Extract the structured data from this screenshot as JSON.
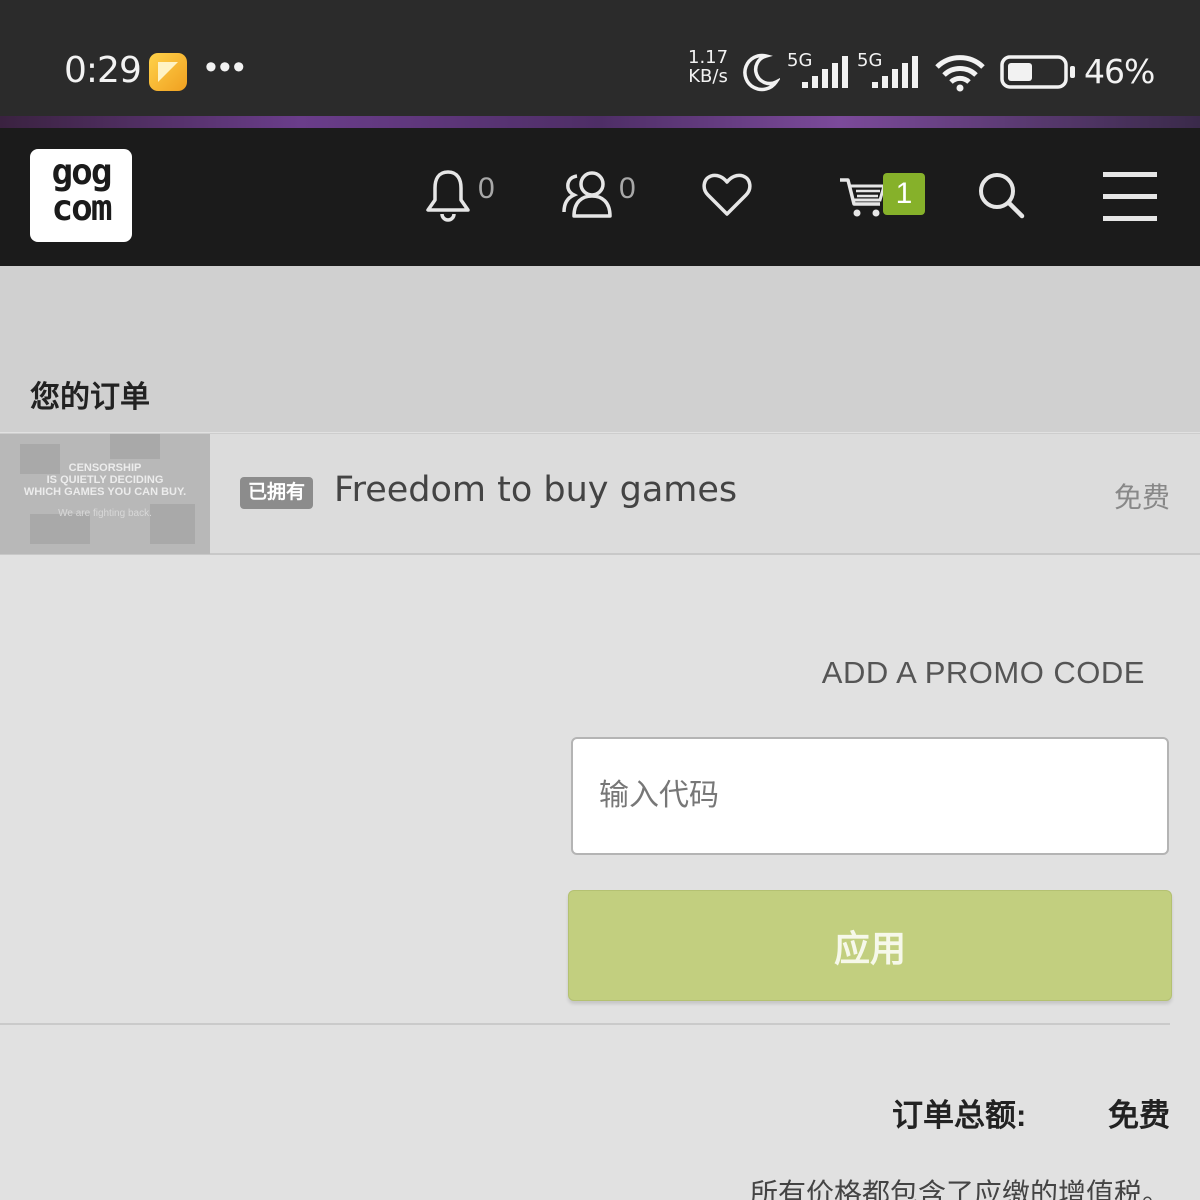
{
  "status_bar": {
    "time": "0:29",
    "more": "•••",
    "net_speed_value": "1.17",
    "net_speed_unit": "KB/s",
    "sim1": "5G",
    "sim2": "5G",
    "battery": "46%",
    "battery_level": 0.46,
    "icons": [
      "app-notification-icon",
      "moon-icon",
      "signal-icon",
      "signal-icon",
      "wifi-icon",
      "battery-icon"
    ]
  },
  "header": {
    "logo_top": "gog",
    "logo_bottom": "com",
    "notifications_count": "0",
    "friends_count": "0",
    "cart_count": "1",
    "accent": "#86b12a"
  },
  "order": {
    "title": "您的订单",
    "item": {
      "thumb_line1": "CENSORSHIP",
      "thumb_line2": "IS QUIETLY DECIDING",
      "thumb_line3": "WHICH GAMES YOU CAN BUY.",
      "thumb_sub": "We are fighting back.",
      "badge": "已拥有",
      "name": "Freedom to buy games",
      "price": "免费"
    }
  },
  "promo": {
    "title": "ADD A PROMO CODE",
    "placeholder": "输入代码",
    "apply_label": "应用",
    "apply_color": "#c2cf7f"
  },
  "summary": {
    "total_label": "订单总额:",
    "total_value": "免费",
    "vat_note": "所有价格都包含了应缴的增值税。"
  }
}
